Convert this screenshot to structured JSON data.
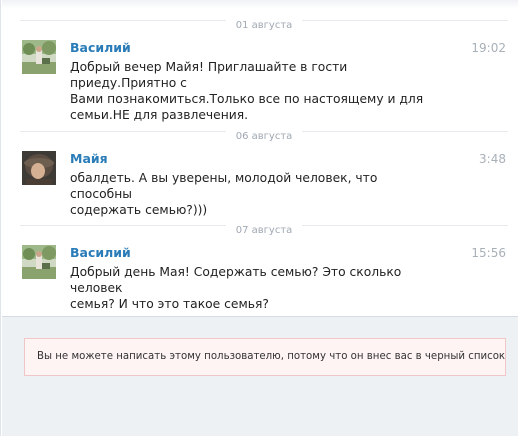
{
  "conversation": {
    "messages": [
      {
        "date": "01 августа",
        "author": "Василий",
        "time": "19:02",
        "text": "Добрый вечер Майя! Приглашайте в гости приеду.Приятно с\nВами познакомиться.Только все по настоящему и для\nсемьи.НЕ для развлечения."
      },
      {
        "date": "06 августа",
        "author": "Майя",
        "time": "3:48",
        "text": "обалдеть. А вы уверены, молодой человек, что способны\nсодержать семью?)))"
      },
      {
        "date": "07 августа",
        "author": "Василий",
        "time": "15:56",
        "text": "Добрый день Мая! Содержать семью? Это сколько человек\nсемья? И что это такое семья?"
      }
    ]
  },
  "notice": {
    "text": "Вы не можете написать этому пользователю, потому что он внес вас в черный список."
  },
  "colors": {
    "author_link": "#2a7cb8",
    "time": "#a8b0b8",
    "date_separator": "#a0a8b2",
    "notice_background": "#fff4f4",
    "notice_border": "#f0c6c6",
    "bottom_panel": "#eef1f4"
  },
  "icons": {
    "avatar_vasily": "user-photo-outdoor",
    "avatar_maya": "user-photo-portrait"
  }
}
